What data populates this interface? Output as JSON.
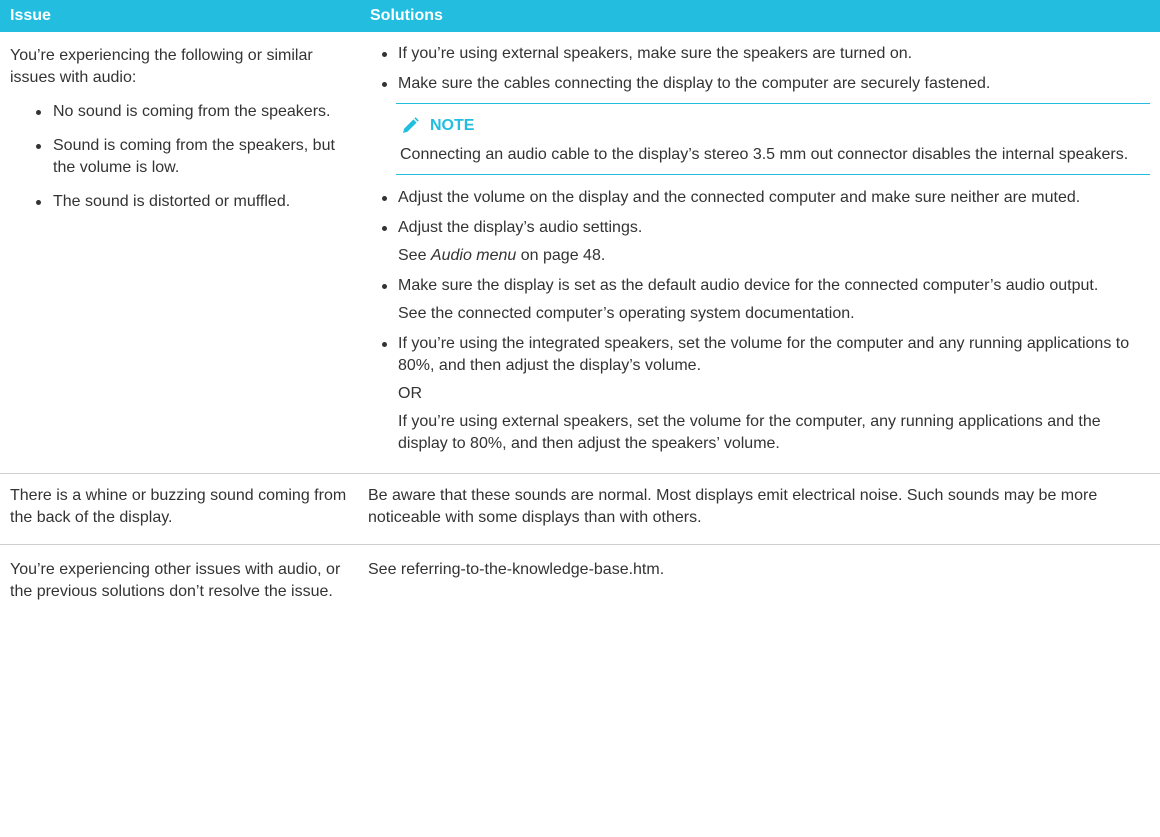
{
  "headers": {
    "issue": "Issue",
    "solutions": "Solutions"
  },
  "colors": {
    "accent": "#23bedf",
    "text": "#333333",
    "divider": "#cfcfcf"
  },
  "row1": {
    "issue_intro": "You’re experiencing the following or similar issues with audio:",
    "issue_items": [
      "No sound is coming from the speakers.",
      "Sound is coming from the speakers, but the volume is low.",
      "The sound is distorted or muffled."
    ],
    "sol_1": "If you’re using external speakers, make sure the speakers are turned on.",
    "sol_2": "Make sure the cables connecting the display to the computer are securely fastened.",
    "note_icon": "pencil-icon",
    "note_label": "NOTE",
    "note_text": "Connecting an audio cable to the display’s stereo 3.5 mm out connector disables the internal speakers.",
    "sol_3": "Adjust the volume on the display and the connected computer and make sure neither are muted.",
    "sol_4": "Adjust the display’s audio settings.",
    "sol_4_see_prefix": "See ",
    "sol_4_see_link": "Audio menu",
    "sol_4_see_suffix": " on page 48.",
    "sol_5": "Make sure the display is set as the default audio device for the connected computer’s audio output.",
    "sol_5_see": "See the connected computer’s operating system documentation.",
    "sol_6": "If you’re using the integrated speakers, set the volume for the computer and any running applications to 80%, and then adjust the display’s volume.",
    "sol_6_or": "OR",
    "sol_6_alt": "If you’re using external speakers, set the volume for the computer, any running applications and the display to 80%, and then adjust the speakers’ volume."
  },
  "row2": {
    "issue": "There is a whine or buzzing sound coming from the back of the display.",
    "solution": "Be aware that these sounds are normal. Most displays emit electrical noise. Such sounds may be more noticeable with some displays than with others."
  },
  "row3": {
    "issue": "You’re experiencing other issues with audio, or the previous solutions don’t resolve the issue.",
    "solution": "See referring-to-the-knowledge-base.htm."
  }
}
